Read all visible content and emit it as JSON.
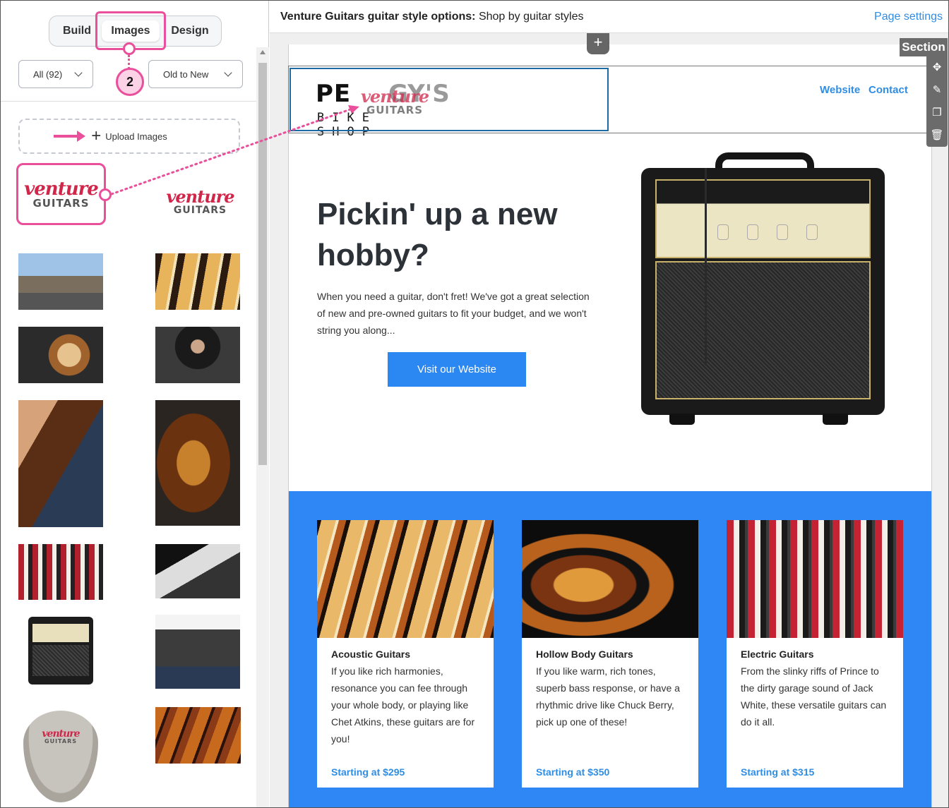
{
  "left_panel": {
    "tabs": [
      {
        "label": "Build"
      },
      {
        "label": "Images"
      },
      {
        "label": "Design"
      }
    ],
    "active_tab": "Images",
    "step_badge": "2",
    "filter_dropdown": "All (92)",
    "sort_dropdown": "Old to New",
    "upload_label": "Upload Images",
    "logos": {
      "venture": "venture",
      "guitars": "GUITARS"
    },
    "guitar_pick": {
      "venture": "venture",
      "guitars": "GUITARS"
    }
  },
  "topbar": {
    "title_bold": "Venture Guitars guitar style options:",
    "title_rest": "Shop by guitar styles",
    "page_settings": "Page settings"
  },
  "editor": {
    "section_label": "Section",
    "add_icon": "+",
    "tool_icons": [
      "move-icon",
      "pencil-icon",
      "duplicate-icon",
      "trash-icon"
    ]
  },
  "email": {
    "header": {
      "logo_text_pe": "PE",
      "logo_text_ys": "GY'S",
      "logo_subtext": "BIKE SHOP",
      "drag_logo_venture": "venture",
      "drag_logo_guitars": "GUITARS",
      "nav": [
        "Website",
        "Contact"
      ]
    },
    "hero": {
      "heading": "Pickin' up a new hobby?",
      "body": "When you need a guitar, don't fret! We've got a great selection of new and pre-owned guitars to fit your budget, and we won't string you along...",
      "button": "Visit our Website"
    },
    "cards": [
      {
        "title": "Acoustic Guitars",
        "body": "If you like rich harmonies, resonance you can fee through your whole body, or playing like Chet Atkins, these guitars are for you!",
        "price": "Starting at $295"
      },
      {
        "title": "Hollow Body Guitars",
        "body": "If you like warm, rich tones, superb bass response, or have a rhythmic drive like Chuck Berry, pick up one of these!",
        "price": "Starting at $350"
      },
      {
        "title": "Electric Guitars",
        "body": "From the slinky riffs of Prince to the dirty garage sound of Jack White, these versatile guitars can do it all.",
        "price": "Starting at $315"
      }
    ]
  },
  "colors": {
    "accent_pink": "#e94f9a",
    "link_blue": "#2f8de4",
    "cta_blue": "#2b87f2",
    "band_blue": "#2f86f5",
    "venture_red": "#d0264a"
  }
}
